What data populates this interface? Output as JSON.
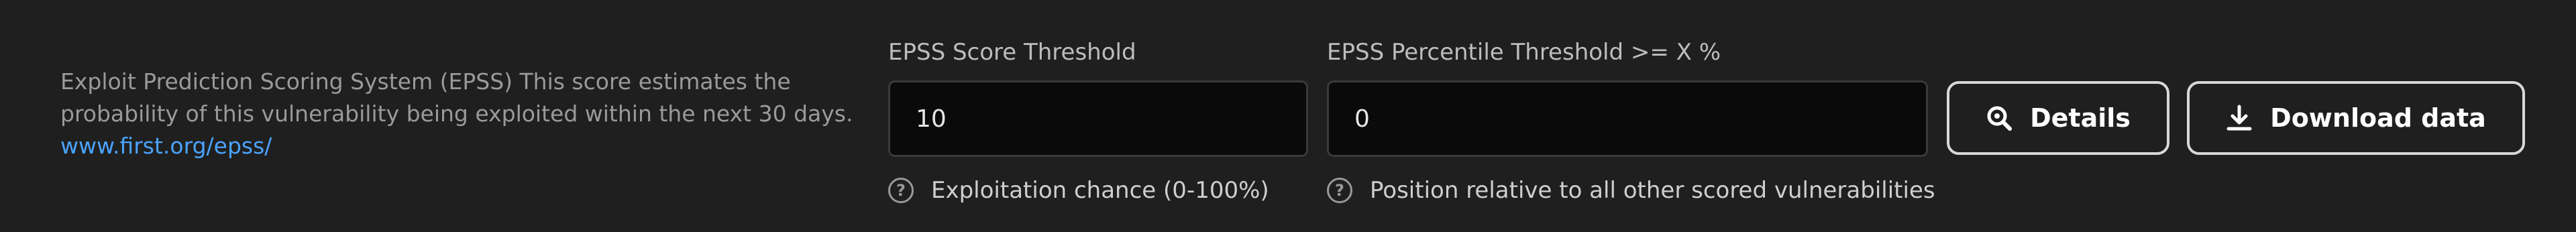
{
  "epss": {
    "description": "Exploit Prediction Scoring System (EPSS) This score estimates the probability of this vulnerability being exploited within the next 30 days.",
    "description_line1": "Exploit Prediction Scoring System (EPSS) This score estimates the",
    "description_line2": "probability of this vulnerability being exploited within the next 30 days.",
    "link_text": "www.first.org/epss/",
    "link_color": "#4aa3ff"
  },
  "score_threshold": {
    "label": "EPSS Score Threshold",
    "value": "10",
    "hint": "Exploitation chance (0-100%)"
  },
  "percentile_threshold": {
    "label": "EPSS Percentile Threshold >= X %",
    "value": "0",
    "hint": "Position relative to all other scored vulnerabilities"
  },
  "buttons": {
    "details": {
      "label": "Details",
      "icon": "search-details-icon"
    },
    "download": {
      "label": "Download data",
      "icon": "download-icon"
    }
  },
  "theme": {
    "background": "#1f1f1f",
    "input_background": "#0a0a0a",
    "button_border": "#d8d8d8"
  }
}
